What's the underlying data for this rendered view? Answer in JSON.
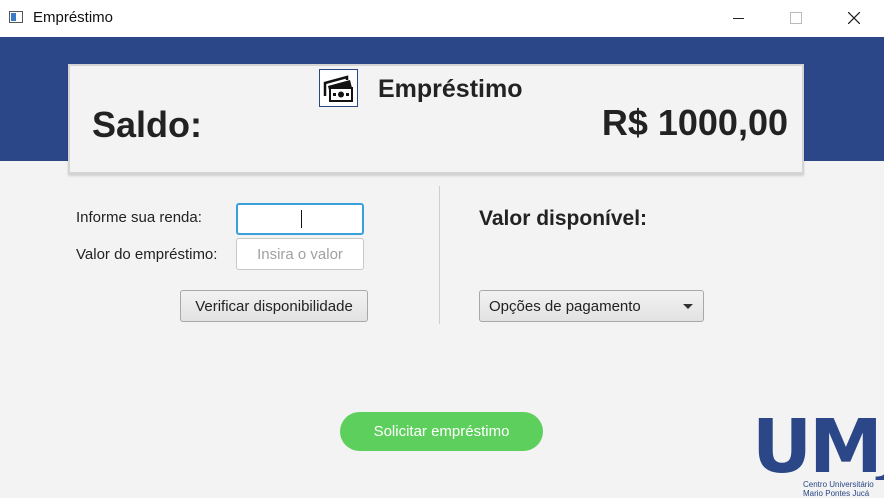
{
  "window": {
    "title": "Empréstimo"
  },
  "header": {
    "title": "Empréstimo",
    "saldo_label": "Saldo:",
    "saldo_value": "R$ 1000,00"
  },
  "form": {
    "renda_label": "Informe sua renda:",
    "renda_value": "",
    "valor_label": "Valor do empréstimo:",
    "valor_placeholder": "Insira o valor",
    "verificar_button": "Verificar disponibilidade"
  },
  "result": {
    "valor_disponivel_label": "Valor disponível:",
    "opcoes_select": "Opções de pagamento"
  },
  "actions": {
    "solicitar_button": "Solicitar empréstimo"
  },
  "logo": {
    "text": "UMJ",
    "line1": "Centro Universitário",
    "line2": "Mario Pontes Jucá"
  },
  "colors": {
    "header": "#2b4788",
    "accent_green": "#5dcf5d",
    "focus": "#3aa0dc"
  },
  "icons": {
    "app": "window-icon",
    "card": "money-icon",
    "minimize": "minimize-icon",
    "maximize": "maximize-icon",
    "close": "close-icon",
    "dropdown": "chevron-down-icon"
  }
}
